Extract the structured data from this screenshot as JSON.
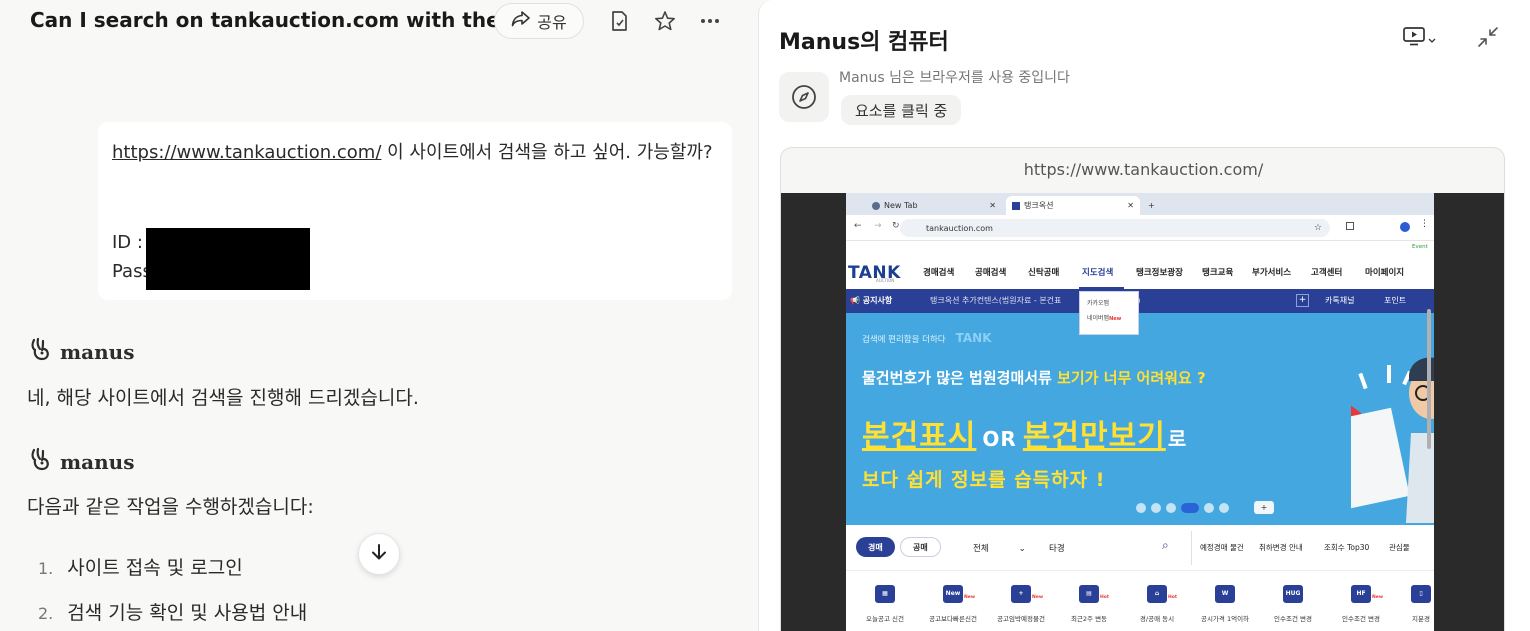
{
  "chat": {
    "title": "Can I search on tankauction.com with thes...",
    "share_label": "공유",
    "user_message": {
      "link": "https://www.tankauction.com/",
      "text_after_link": " 이 사이트에서 검색을 하고 싶어. 가능할까?",
      "id_label": "ID :",
      "pass_label": "Pass"
    },
    "agent_name": "manus",
    "agent_messages": [
      "네, 해당 사이트에서 검색을 진행해 드리겠습니다.",
      "다음과 같은 작업을 수행하겠습니다:"
    ],
    "steps": [
      {
        "num": "1.",
        "text": "사이트 접속 및 로그인"
      },
      {
        "num": "2.",
        "text": "검색 기능 확인 및 사용법 안내"
      }
    ]
  },
  "computer": {
    "title": "Manus의 컴퓨터",
    "status_text": "Manus 님은 브라우저를 사용 중입니다",
    "status_chip": "요소를 클릭 중",
    "viewer_url": "https://www.tankauction.com/"
  },
  "browser": {
    "tabs": [
      "New Tab",
      "탱크옥션"
    ],
    "address": "tankauction.com",
    "event_tag": "Event",
    "logo": "TANK",
    "logo_sub": "AUCTION",
    "nav": [
      "경매검색",
      "공매검색",
      "신탁공매",
      "지도검색",
      "탱크정보광장",
      "탱크교육",
      "부가서비스",
      "고객센터",
      "마이페이지"
    ],
    "nav_active": "지도검색",
    "dropdown": [
      "카카오맵",
      "네이버맵"
    ],
    "dropdown_new": "New",
    "notice_label": "공지사항",
    "notice_text": "탱크옥션 추가컨텐스(법원자료 - 본건표",
    "notice_text_tail": ")",
    "notice_right": [
      "카톡채널",
      "포인트"
    ],
    "banner": {
      "small": "검색에 편리함을 더하다",
      "small_logo": "TANK",
      "line1_white": "물건번호가 많은 법원경매서류 ",
      "line1_yellow": "보기가 너무 어려워요 ?",
      "big1": "본건표시",
      "or": "OR",
      "big2": "본건만보기",
      "big_suffix": "로",
      "line3": "보다 쉽게 정보를 습득하자 !"
    },
    "search": {
      "pill_on": "경매",
      "pill_off": "공매",
      "scope": "전체",
      "type": "타경",
      "links": [
        "예정경매 물건",
        "취하변경 안내",
        "조회수 Top30",
        "관심물"
      ]
    },
    "quick": [
      {
        "label": "오늘공고 신건",
        "icon": "calendar-icon",
        "badge": ""
      },
      {
        "label": "공고보다빠른신건",
        "icon": "New",
        "badge": "New"
      },
      {
        "label": "공고임박예정물건",
        "icon": "calendar-plus-icon",
        "badge": "New"
      },
      {
        "label": "최근2주 변동",
        "icon": "clipboard-icon",
        "badge": "Hot"
      },
      {
        "label": "경/공매 동시",
        "icon": "house-icon",
        "badge": "Hot"
      },
      {
        "label": "공시가격 1억이하",
        "icon": "W",
        "badge": ""
      },
      {
        "label": "인수조건 변경",
        "icon": "HUG",
        "badge": ""
      },
      {
        "label": "인수조건 변경",
        "icon": "HF",
        "badge": "New"
      },
      {
        "label": "지분경",
        "icon": "document-icon",
        "badge": ""
      }
    ]
  }
}
